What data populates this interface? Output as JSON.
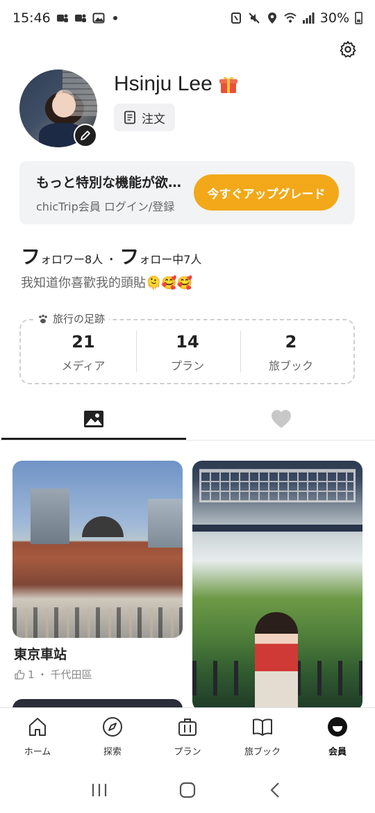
{
  "status_bar": {
    "time": "15:46",
    "battery_text": "30%",
    "icons": [
      "teams-icon",
      "teams-icon",
      "gallery-icon",
      "notification-dot",
      "nfc-icon",
      "mute-icon",
      "location-icon",
      "wifi-icon",
      "signal-icon",
      "battery-icon"
    ]
  },
  "profile": {
    "name": "Hsinju Lee",
    "order_label": "注文",
    "followers_prefix": "フ",
    "followers_text": "ォロワー8人",
    "separator": "・",
    "following_prefix": "フ",
    "following_text": "ォロー中7人",
    "bio": "我知道你喜歡我的頭貼🫠🥰🥰"
  },
  "upgrade": {
    "title": "もっと特別な機能が欲しいですか？",
    "subtitle": "chicTrip会員 ログイン/登録",
    "button": "今すぐアップグレード"
  },
  "footprint": {
    "title": "旅行の足跡",
    "stats": [
      {
        "value": "21",
        "label": "メディア"
      },
      {
        "value": "14",
        "label": "プラン"
      },
      {
        "value": "2",
        "label": "旅ブック"
      }
    ]
  },
  "tabs": [
    {
      "name": "media",
      "icon": "image-icon",
      "active": true
    },
    {
      "name": "likes",
      "icon": "heart-icon",
      "active": false
    }
  ],
  "posts": [
    {
      "title": "東京車站",
      "likes": "1",
      "location": "千代田區"
    }
  ],
  "bottom_nav": [
    {
      "label": "ホーム",
      "icon": "home-icon"
    },
    {
      "label": "探索",
      "icon": "compass-icon"
    },
    {
      "label": "プラン",
      "icon": "suitcase-icon"
    },
    {
      "label": "旅ブック",
      "icon": "book-icon"
    },
    {
      "label": "会員",
      "icon": "member-icon",
      "active": true
    }
  ],
  "colors": {
    "accent": "#f2a818",
    "card_bg": "#f2f3f5",
    "text_primary": "#222222",
    "text_secondary": "#666666"
  }
}
